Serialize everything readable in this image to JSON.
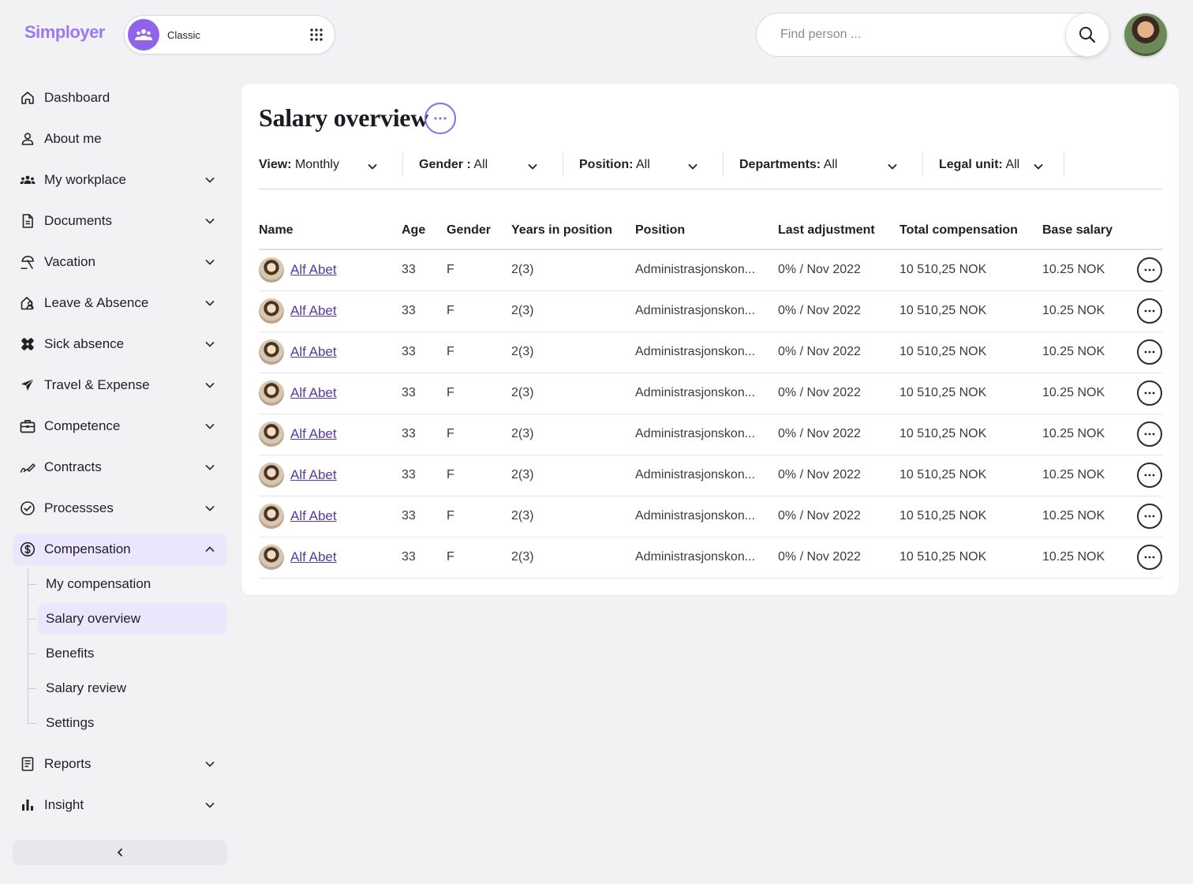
{
  "app": {
    "logo": "Simployer",
    "workspace_label": "Classic",
    "search": {
      "placeholder": "Find person ..."
    }
  },
  "colors": {
    "accent": "#8f64ea",
    "active_bg": "#ece6fc",
    "link": "#553a9c",
    "background": "#f2f2f5"
  },
  "sidebar": {
    "items": [
      {
        "label": "Dashboard",
        "icon": "home-icon"
      },
      {
        "label": "About me",
        "icon": "user-icon"
      },
      {
        "label": "My workplace",
        "icon": "team-icon"
      },
      {
        "label": "Documents",
        "icon": "document-icon"
      },
      {
        "label": "Vacation",
        "icon": "beach-umbrella-icon"
      },
      {
        "label": "Leave & Absence",
        "icon": "home-person-icon"
      },
      {
        "label": "Sick absence",
        "icon": "bandage-icon"
      },
      {
        "label": "Travel & Expense",
        "icon": "airplane-icon"
      },
      {
        "label": "Competence",
        "icon": "briefcase-icon"
      },
      {
        "label": "Contracts",
        "icon": "signature-icon"
      },
      {
        "label": "Processses",
        "icon": "check-circle-icon"
      },
      {
        "label": "Compensation",
        "icon": "dollar-circle-icon"
      }
    ],
    "sub_items": [
      {
        "label": "My compensation"
      },
      {
        "label": "Salary overview"
      },
      {
        "label": "Benefits"
      },
      {
        "label": "Salary review"
      },
      {
        "label": "Settings"
      }
    ],
    "bottom_items": [
      {
        "label": "Reports",
        "icon": "report-icon"
      },
      {
        "label": "Insight",
        "icon": "bar-chart-icon"
      }
    ]
  },
  "main": {
    "title": "Salary overview",
    "filters": [
      {
        "key": "View:",
        "value": " Monthly"
      },
      {
        "key": "Gender :",
        "value": " All"
      },
      {
        "key": "Position:",
        "value": " All"
      },
      {
        "key": "Departments:",
        "value": " All"
      },
      {
        "key": "Legal unit:",
        "value": " All"
      }
    ],
    "table": {
      "columns": [
        "Name",
        "Age",
        "Gender",
        "Years in position",
        "Position",
        "Last adjustment",
        "Total compensation",
        "Base salary"
      ],
      "rows": [
        [
          "Alf Abet",
          "33",
          "F",
          "2(3)",
          "Administrasjonskon...",
          "0% / Nov 2022",
          "10 510,25 NOK",
          "10.25 NOK"
        ],
        [
          "Alf Abet",
          "33",
          "F",
          "2(3)",
          "Administrasjonskon...",
          "0% / Nov 2022",
          "10 510,25 NOK",
          "10.25 NOK"
        ],
        [
          "Alf Abet",
          "33",
          "F",
          "2(3)",
          "Administrasjonskon...",
          "0% / Nov 2022",
          "10 510,25 NOK",
          "10.25 NOK"
        ],
        [
          "Alf Abet",
          "33",
          "F",
          "2(3)",
          "Administrasjonskon...",
          "0% / Nov 2022",
          "10 510,25 NOK",
          "10.25 NOK"
        ],
        [
          "Alf Abet",
          "33",
          "F",
          "2(3)",
          "Administrasjonskon...",
          "0% / Nov 2022",
          "10 510,25 NOK",
          "10.25 NOK"
        ],
        [
          "Alf Abet",
          "33",
          "F",
          "2(3)",
          "Administrasjonskon...",
          "0% / Nov 2022",
          "10 510,25 NOK",
          "10.25 NOK"
        ],
        [
          "Alf Abet",
          "33",
          "F",
          "2(3)",
          "Administrasjonskon...",
          "0% / Nov 2022",
          "10 510,25 NOK",
          "10.25 NOK"
        ],
        [
          "Alf Abet",
          "33",
          "F",
          "2(3)",
          "Administrasjonskon...",
          "0% / Nov 2022",
          "10 510,25 NOK",
          "10.25 NOK"
        ]
      ]
    }
  }
}
